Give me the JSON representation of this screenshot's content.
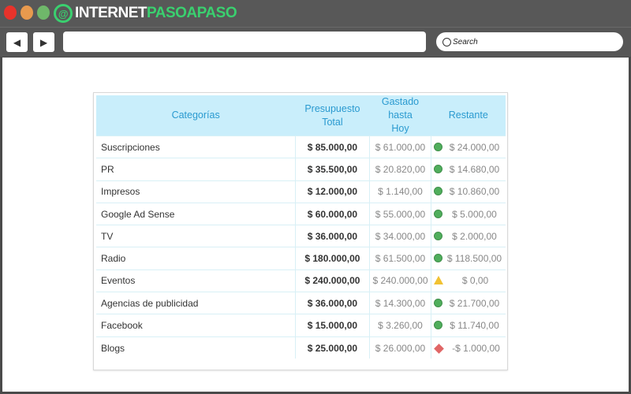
{
  "browser": {
    "logo_white": "INTERNET",
    "logo_green": "PASOAPASO",
    "search_placeholder": "Search",
    "back": "◀",
    "forward": "▶"
  },
  "colors": {
    "ok": "#4fae5c",
    "warn": "#f1c232",
    "bad": "#e06666",
    "header_bg": "#c9eefb"
  },
  "table": {
    "headers": [
      "Categorías",
      "Presupuesto Total",
      "Gastado hasta Hoy",
      "Restante"
    ],
    "rows": [
      {
        "cat": "Suscripciones",
        "total": "$ 85.000,00",
        "spent": "$ 61.000,00",
        "status": "ok",
        "rest": "$ 24.000,00"
      },
      {
        "cat": "PR",
        "total": "$ 35.500,00",
        "spent": "$ 20.820,00",
        "status": "ok",
        "rest": "$ 14.680,00"
      },
      {
        "cat": "Impresos",
        "total": "$ 12.000,00",
        "spent": "$ 1.140,00",
        "status": "ok",
        "rest": "$ 10.860,00"
      },
      {
        "cat": "Google Ad Sense",
        "total": "$ 60.000,00",
        "spent": "$ 55.000,00",
        "status": "ok",
        "rest": "$ 5.000,00"
      },
      {
        "cat": "TV",
        "total": "$ 36.000,00",
        "spent": "$ 34.000,00",
        "status": "ok",
        "rest": "$ 2.000,00"
      },
      {
        "cat": "Radio",
        "total": "$ 180.000,00",
        "spent": "$ 61.500,00",
        "status": "ok",
        "rest": "$ 118.500,00"
      },
      {
        "cat": "Eventos",
        "total": "$ 240.000,00",
        "spent": "$ 240.000,00",
        "status": "warn",
        "rest": "$ 0,00"
      },
      {
        "cat": "Agencias de publicidad",
        "total": "$ 36.000,00",
        "spent": "$ 14.300,00",
        "status": "ok",
        "rest": "$ 21.700,00"
      },
      {
        "cat": "Facebook",
        "total": "$ 15.000,00",
        "spent": "$ 3.260,00",
        "status": "ok",
        "rest": "$ 11.740,00"
      },
      {
        "cat": "Blogs",
        "total": "$ 25.000,00",
        "spent": "$ 26.000,00",
        "status": "bad",
        "rest": "-$ 1.000,00"
      }
    ]
  }
}
